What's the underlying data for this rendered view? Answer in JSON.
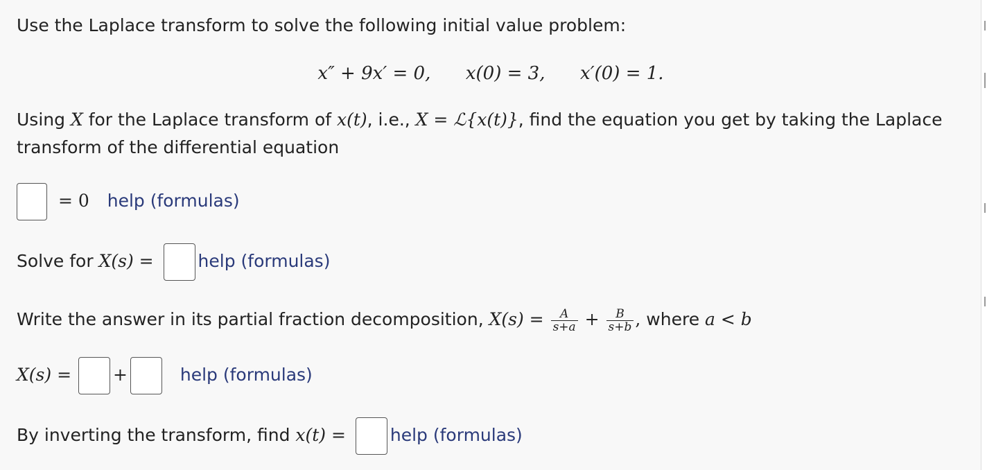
{
  "problem": {
    "intro": "Use the Laplace transform to solve the following initial value problem:",
    "ode": "x″ + 9x′ = 0,",
    "ic1": "x(0) = 3,",
    "ic2": "x′(0) = 1."
  },
  "step1": {
    "p1": "Using ",
    "var_X": "X",
    "p2": " for the Laplace transform of ",
    "var_xt": "x(t)",
    "p3": ", i.e., ",
    "def": "X = ℒ{x(t)}",
    "p4": ", find the equation you get by taking the Laplace",
    "line2": "transform of the differential equation",
    "eq_rhs": "= 0",
    "help": "help (formulas)"
  },
  "step2": {
    "label": "Solve for ",
    "expr": "X(s) =",
    "help": "help (formulas)"
  },
  "step3": {
    "text": "Write the answer in its partial fraction decomposition, ",
    "expr": "X(s) =",
    "frac1_num": "A",
    "frac1_den": "s+a",
    "plus": "+",
    "frac2_num": "B",
    "frac2_den": "s+b",
    "comma": ",",
    "where": " where ",
    "cond": "a < b",
    "answer_lhs": "X(s) =",
    "answer_plus": "+",
    "help": "help (formulas)"
  },
  "step4": {
    "text": "By inverting the transform, find ",
    "expr": "x(t) =",
    "help": "help (formulas)"
  }
}
